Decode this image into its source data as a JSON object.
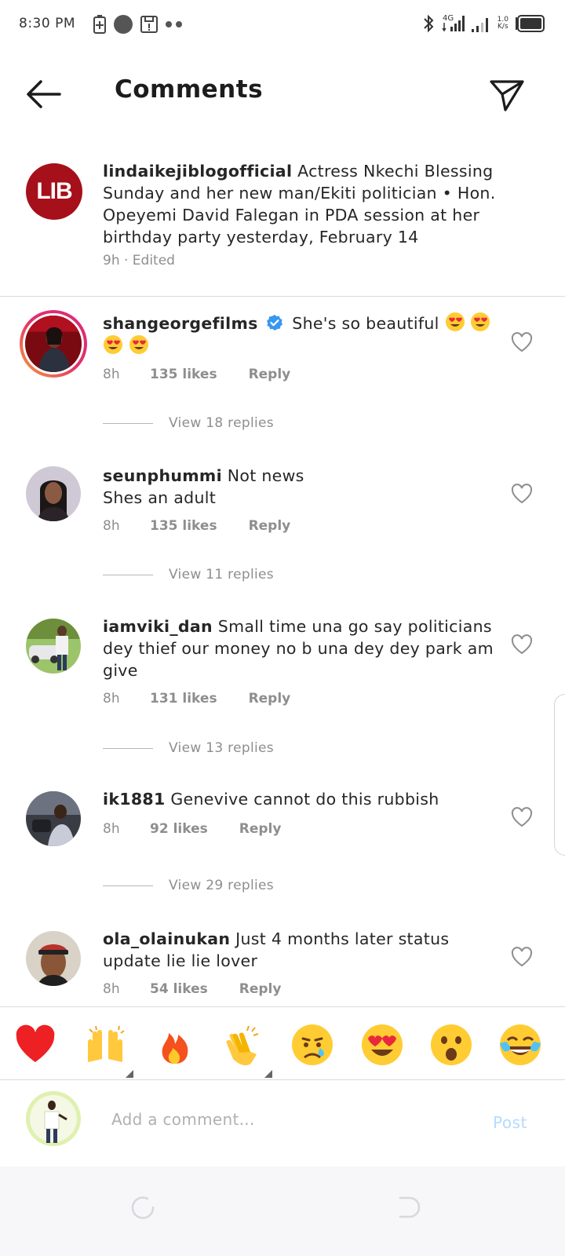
{
  "status_bar": {
    "time": "8:30 PM",
    "network_type": "4G",
    "speed_value": "1.0",
    "speed_unit": "K/s"
  },
  "header": {
    "title": "Comments"
  },
  "caption": {
    "avatar_text": "LIB",
    "username": "lindaikejiblogofficial",
    "text": "Actress Nkechi Blessing Sunday and her new man/Ekiti politician • Hon. Opeyemi David Falegan in PDA session at her birthday party yesterday, February 14",
    "meta": "9h · Edited"
  },
  "comments": [
    {
      "username": "shangeorgefilms",
      "verified": true,
      "text": "She's so beautiful",
      "emoji_count": 4,
      "time": "8h",
      "likes": "135 likes",
      "reply": "Reply",
      "view_replies": "View 18 replies"
    },
    {
      "username": "seunphummi",
      "text": "Not news",
      "text2": "Shes an adult",
      "time": "8h",
      "likes": "135 likes",
      "reply": "Reply",
      "view_replies": "View 11 replies"
    },
    {
      "username": "iamviki_dan",
      "text": "Small time una go say politicians dey thief our money no b una dey dey park am give",
      "time": "8h",
      "likes": "131 likes",
      "reply": "Reply",
      "view_replies": "View 13 replies"
    },
    {
      "username": "ik1881",
      "text": "Genevive cannot do this rubbish",
      "time": "8h",
      "likes": "92 likes",
      "reply": "Reply",
      "view_replies": "View 29 replies"
    },
    {
      "username": "ola_olainukan",
      "text": "Just 4 months later status update lie lie lover",
      "time": "8h",
      "likes": "54 likes",
      "reply": "Reply"
    }
  ],
  "emoji_bar": [
    "heart",
    "raised-hands",
    "fire",
    "clapping-hands",
    "crying-face",
    "heart-eyes-face",
    "surprised-face",
    "tears-of-joy-face"
  ],
  "input": {
    "placeholder": "Add a comment...",
    "post_label": "Post"
  },
  "colors": {
    "primary_text": "#262626",
    "secondary_text": "#8e8e8e",
    "post_disabled": "#b3dbff",
    "verified_blue": "#3897f0",
    "heart_red": "#ed2024",
    "lib_red": "#a6101a"
  }
}
